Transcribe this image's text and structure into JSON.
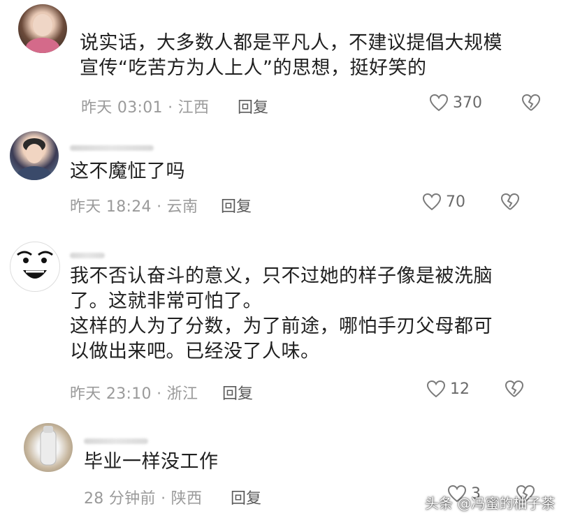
{
  "comments": [
    {
      "text": "说实话，大多数人都是平凡人，不建议提倡大规模\n宣传“吃苦方为人上人”的思想，挺好笑的",
      "meta": "昨天 03:01 · 江西",
      "reply_label": "回复",
      "likes": "370"
    },
    {
      "text": "这不魔怔了吗",
      "meta": "昨天 18:24 · 云南",
      "reply_label": "回复",
      "likes": "70"
    },
    {
      "text": "我不否认奋斗的意义，只不过她的样子像是被洗脑\n了。这就非常可怕了。\n这样的人为了分数，为了前途，哪怕手刃父母都可\n以做出来吧。已经没了人味。",
      "meta": "昨天 23:10 · 浙江",
      "reply_label": "回复",
      "likes": "12"
    },
    {
      "text": "毕业一样没工作",
      "meta": "28 分钟前 · 陕西",
      "reply_label": "回复",
      "likes": "3"
    }
  ],
  "watermark": "头条 @冯蜜的柚子茶",
  "colors": {
    "text": "#202020",
    "meta": "#9a9a9a",
    "icon": "#7a7a7a"
  }
}
